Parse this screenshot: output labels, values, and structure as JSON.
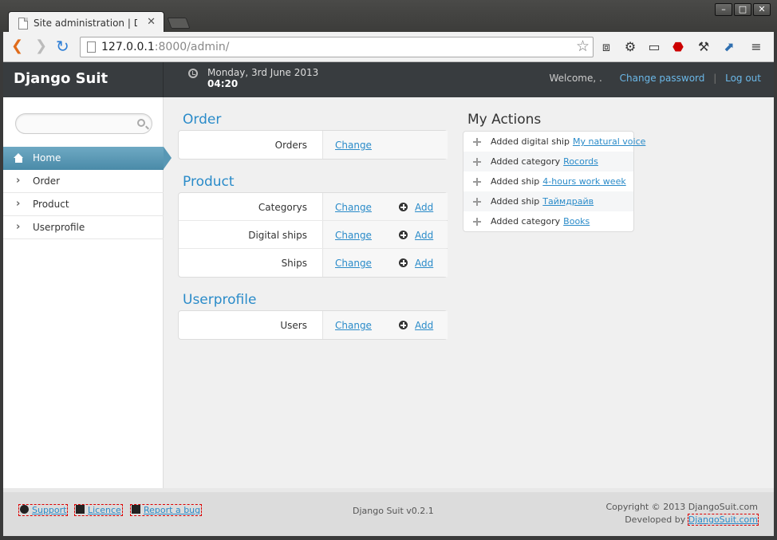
{
  "browser": {
    "tab_title": "Site administration | Djang",
    "url_host": "127.0.0.1",
    "url_rest": ":8000/admin/",
    "window_controls": [
      "–",
      "□",
      "✕"
    ]
  },
  "header": {
    "brand": "Django Suit",
    "date": "Monday, 3rd June 2013",
    "time": "04:20",
    "welcome": "Welcome, .",
    "change_password": "Change password",
    "separator": "|",
    "logout": "Log out"
  },
  "sidebar": {
    "search_placeholder": "",
    "items": [
      {
        "label": "Home",
        "active": true
      },
      {
        "label": "Order"
      },
      {
        "label": "Product"
      },
      {
        "label": "Userprofile"
      }
    ]
  },
  "modules": [
    {
      "title": "Order",
      "rows": [
        {
          "name": "Orders",
          "change": "Change",
          "add": ""
        }
      ]
    },
    {
      "title": "Product",
      "rows": [
        {
          "name": "Categorys",
          "change": "Change",
          "add": "Add"
        },
        {
          "name": "Digital ships",
          "change": "Change",
          "add": "Add"
        },
        {
          "name": "Ships",
          "change": "Change",
          "add": "Add"
        }
      ]
    },
    {
      "title": "Userprofile",
      "rows": [
        {
          "name": "Users",
          "change": "Change",
          "add": "Add"
        }
      ]
    }
  ],
  "my_actions": {
    "title": "My Actions",
    "items": [
      {
        "text": "Added digital ship",
        "link": "My natural voice"
      },
      {
        "text": "Added category",
        "link": "Rocords"
      },
      {
        "text": "Added ship",
        "link": "4-hours work week"
      },
      {
        "text": "Added ship",
        "link": "Таймдрайв"
      },
      {
        "text": "Added category",
        "link": "Books"
      }
    ]
  },
  "footer": {
    "support": "Support",
    "licence": "Licence",
    "report_bug": "Report a bug",
    "version": "Django Suit v0.2.1",
    "copyright": "Copyright © 2013 DjangoSuit.com",
    "developed_by": "Developed by",
    "developer_link": "DjangoSuit.com"
  },
  "colors": {
    "link": "#2a8bc9",
    "header_bg": "#383c3f",
    "active_menu": "#5897b4"
  }
}
